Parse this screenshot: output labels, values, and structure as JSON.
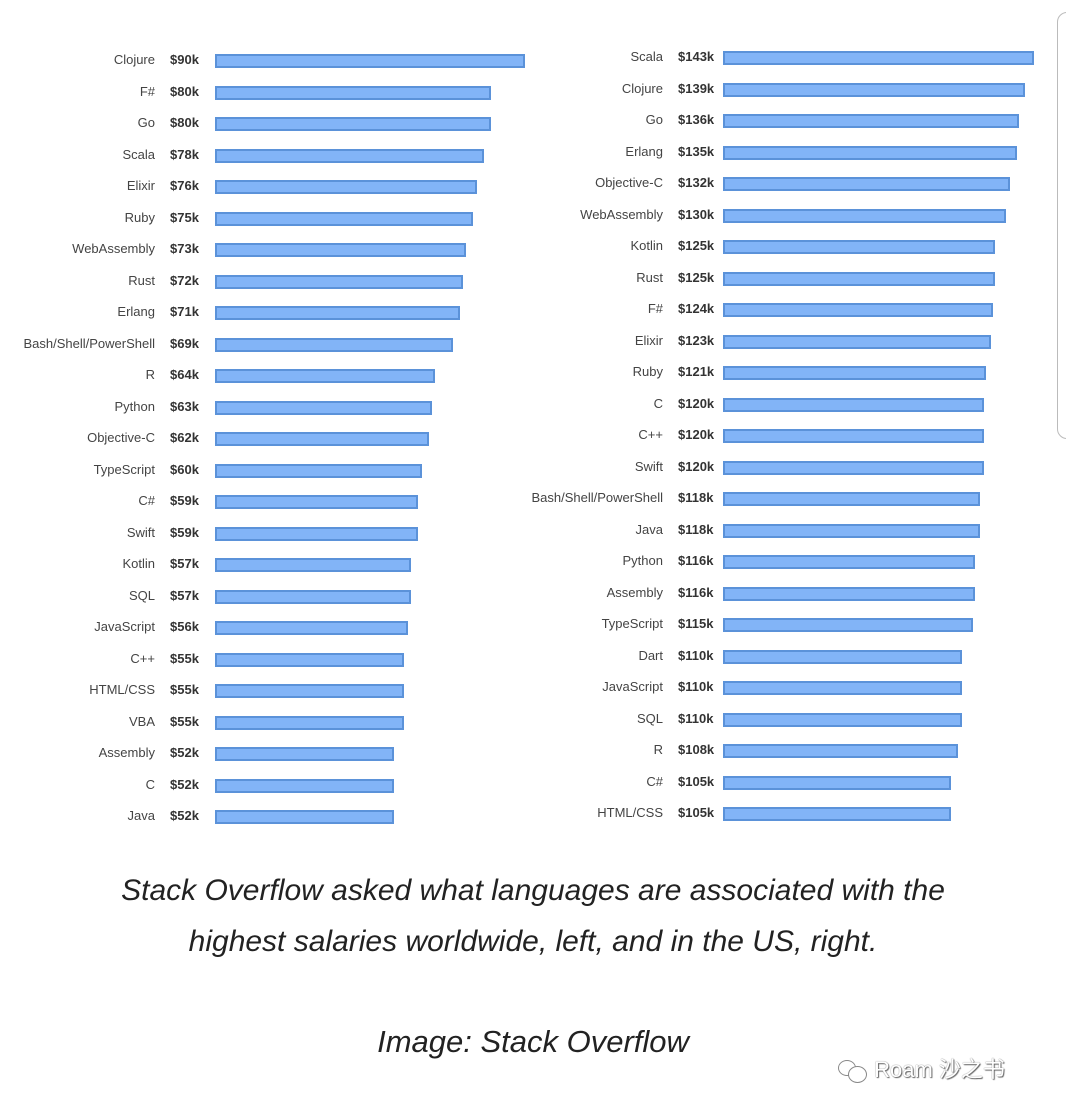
{
  "chart_data": [
    {
      "type": "bar",
      "orientation": "horizontal",
      "region": "worldwide",
      "categories": [
        "Clojure",
        "F#",
        "Go",
        "Scala",
        "Elixir",
        "Ruby",
        "WebAssembly",
        "Rust",
        "Erlang",
        "Bash/Shell/PowerShell",
        "R",
        "Python",
        "Objective-C",
        "TypeScript",
        "C#",
        "Swift",
        "Kotlin",
        "SQL",
        "JavaScript",
        "C++",
        "HTML/CSS",
        "VBA",
        "Assembly",
        "C",
        "Java"
      ],
      "values": [
        90,
        80,
        80,
        78,
        76,
        75,
        73,
        72,
        71,
        69,
        64,
        63,
        62,
        60,
        59,
        59,
        57,
        57,
        56,
        55,
        55,
        55,
        52,
        52,
        52
      ],
      "value_labels": [
        "$90k",
        "$80k",
        "$80k",
        "$78k",
        "$76k",
        "$75k",
        "$73k",
        "$72k",
        "$71k",
        "$69k",
        "$64k",
        "$63k",
        "$62k",
        "$60k",
        "$59k",
        "$59k",
        "$57k",
        "$57k",
        "$56k",
        "$55k",
        "$55k",
        "$55k",
        "$52k",
        "$52k",
        "$52k"
      ],
      "unit": "thousand USD",
      "xlim": [
        0,
        90
      ],
      "grid": false,
      "bar_color": "#82b4f7",
      "bar_border": "#5b92d9"
    },
    {
      "type": "bar",
      "orientation": "horizontal",
      "region": "US",
      "categories": [
        "Scala",
        "Clojure",
        "Go",
        "Erlang",
        "Objective-C",
        "WebAssembly",
        "Kotlin",
        "Rust",
        "F#",
        "Elixir",
        "Ruby",
        "C",
        "C++",
        "Swift",
        "Bash/Shell/PowerShell",
        "Java",
        "Python",
        "Assembly",
        "TypeScript",
        "Dart",
        "JavaScript",
        "SQL",
        "R",
        "C#",
        "HTML/CSS"
      ],
      "values": [
        143,
        139,
        136,
        135,
        132,
        130,
        125,
        125,
        124,
        123,
        121,
        120,
        120,
        120,
        118,
        118,
        116,
        116,
        115,
        110,
        110,
        110,
        108,
        105,
        105
      ],
      "value_labels": [
        "$143k",
        "$139k",
        "$136k",
        "$135k",
        "$132k",
        "$130k",
        "$125k",
        "$125k",
        "$124k",
        "$123k",
        "$121k",
        "$120k",
        "$120k",
        "$120k",
        "$118k",
        "$118k",
        "$116k",
        "$116k",
        "$115k",
        "$110k",
        "$110k",
        "$110k",
        "$108k",
        "$105k",
        "$105k"
      ],
      "unit": "thousand USD",
      "xlim": [
        0,
        143
      ],
      "grid": false,
      "bar_color": "#82b4f7",
      "bar_border": "#5b92d9"
    }
  ],
  "caption": {
    "line1": "Stack Overflow asked what languages are associated with the",
    "line2": "highest salaries worldwide, left, and in the US, right."
  },
  "source": "Image: Stack Overflow",
  "watermark": "Roam 沙之书"
}
